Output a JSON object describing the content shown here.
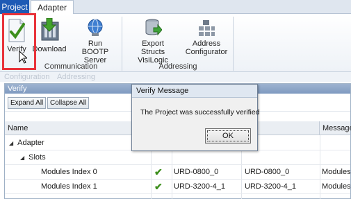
{
  "tabs": {
    "project": "Project",
    "adapter": "Adapter"
  },
  "ribbon": {
    "verify": "Verify",
    "download": "Download",
    "run_bootp_line1": "Run",
    "run_bootp_line2": "BOOTP Server",
    "group_communication": "Communication",
    "export_line1": "Export",
    "export_line2": "Structs VisiLogic",
    "addr_conf_line1": "Address",
    "addr_conf_line2": "Configurator",
    "group_addressing": "Addressing"
  },
  "doc_tabs": {
    "configuration": "Configuration",
    "addressing": "Addressing"
  },
  "panel": {
    "title": "Verify",
    "expand_all": "Expand All",
    "collapse_all": "Collapse All",
    "columns": {
      "name": "Name",
      "adapter": "pter",
      "message": "Message"
    },
    "rows": [
      {
        "name": "Adapter",
        "ok": "",
        "c3": "",
        "c4": "",
        "msg": ""
      },
      {
        "name": "Slots",
        "ok": "",
        "c3": "",
        "c4": "",
        "msg": ""
      },
      {
        "name": "Modules Index 0",
        "ok": "✔",
        "c3": "URD-0800_0",
        "c4": "URD-0800_0",
        "msg": "Modules I"
      },
      {
        "name": "Modules Index 1",
        "ok": "✔",
        "c3": "URD-3200-4_1",
        "c4": "URD-3200-4_1",
        "msg": "Modules I"
      }
    ]
  },
  "dialog": {
    "title": "Verify Message",
    "message": "The Project was successfully verified",
    "ok": "OK"
  },
  "colors": {
    "project_tab": "#1e5ab5",
    "highlight": "#e8323a",
    "check": "#3d8f1d"
  }
}
